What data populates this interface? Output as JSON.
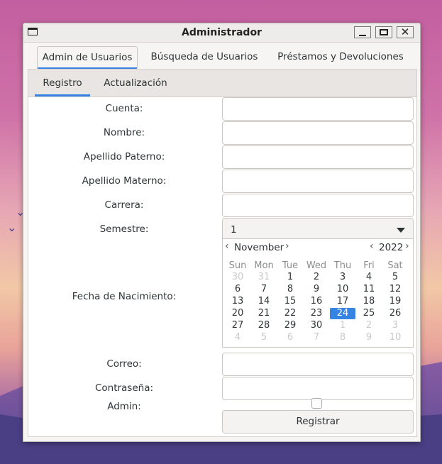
{
  "window": {
    "title": "Administrador"
  },
  "tabs": [
    "Admin de Usuarios",
    "Búsqueda de Usuarios",
    "Préstamos y Devoluciones"
  ],
  "subtabs": [
    "Registro",
    "Actualización"
  ],
  "form": {
    "cuenta_label": "Cuenta:",
    "nombre_label": "Nombre:",
    "apellido_paterno_label": "Apellido Paterno:",
    "apellido_materno_label": "Apellido Materno:",
    "carrera_label": "Carrera:",
    "semestre_label": "Semestre:",
    "semestre_value": "1",
    "fecha_label": "Fecha de Nacimiento:",
    "correo_label": "Correo:",
    "contrasena_label": "Contraseña:",
    "admin_label": "Admin:",
    "admin_checked": false,
    "submit_label": "Registrar"
  },
  "calendar": {
    "month": "November",
    "year": "2022",
    "selected_day": "24",
    "weekdays": [
      "Sun",
      "Mon",
      "Tue",
      "Wed",
      "Thu",
      "Fri",
      "Sat"
    ],
    "weeks": [
      [
        "30",
        "31",
        "1",
        "2",
        "3",
        "4",
        "5"
      ],
      [
        "6",
        "7",
        "8",
        "9",
        "10",
        "11",
        "12"
      ],
      [
        "13",
        "14",
        "15",
        "16",
        "17",
        "18",
        "19"
      ],
      [
        "20",
        "21",
        "22",
        "23",
        "24",
        "25",
        "26"
      ],
      [
        "27",
        "28",
        "29",
        "30",
        "1",
        "2",
        "3"
      ],
      [
        "4",
        "5",
        "6",
        "7",
        "8",
        "9",
        "10"
      ]
    ]
  },
  "colors": {
    "accent": "#3584e4"
  }
}
